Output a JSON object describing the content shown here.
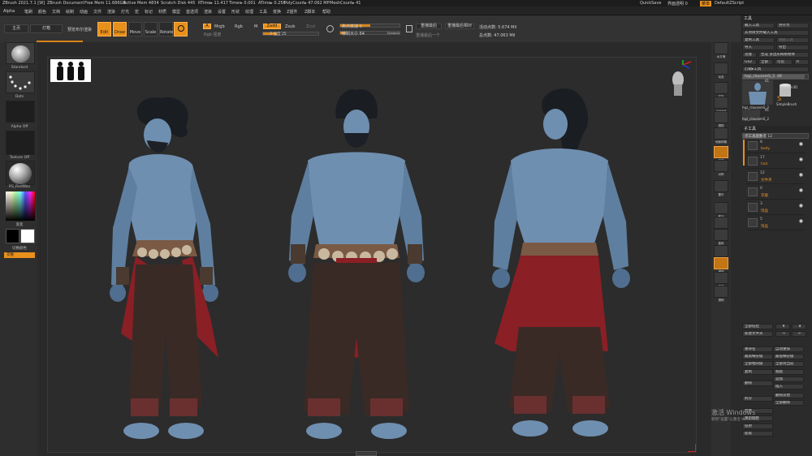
{
  "status_bar": {
    "app": "ZBrush 2021.7.1 [W]",
    "doc": "ZBrush Document",
    "free_mem": "Free Mem 11.686GB",
    "active_mem": "Active Mem 4834",
    "scratch": "Scratch Disk 445",
    "rtime": "RTime▸ 11.417",
    "timer": "Timer▸ 0.001",
    "atime": "ATime▸ 0.256",
    "polycount": "PolyCount▸ 47.062 MP",
    "meshcount": "MeshCount▸ 41",
    "quicksave": "QuickSave",
    "transparency": "界面透明 0",
    "menus_btn": "菜单",
    "default_script": "DefaultZScript"
  },
  "menu_items": [
    "Alpha",
    "笔刷",
    "颜色",
    "文档",
    "绘制",
    "动画",
    "文件",
    "渲染",
    "灯光",
    "宏",
    "标记",
    "材质",
    "模型",
    "首选项",
    "渲染",
    "设置",
    "形状",
    "纹理",
    "工具",
    "变换",
    "Z插件",
    "Z脚本",
    "帮助"
  ],
  "toolbar": {
    "home": "主页",
    "lightbox": "灯箱",
    "preview": "预览布尔渲染",
    "edit": "Edit",
    "draw": "Draw",
    "move": "Move",
    "scale": "Scale",
    "rotate": "Rotate",
    "a_label": "A",
    "mrgb": "Mrgb",
    "rgb": "Rgb",
    "m": "M",
    "zadd": "Zadd",
    "zsub": "Zsub",
    "zcut": "Zcut",
    "rgb_intensity": "Rgb 强度",
    "z_intensity": "Z 强度 25",
    "focal_shift": "焦点衰减 0",
    "draw_size": "绘制大小 64",
    "dynamic": "Dynamic",
    "replay_last": "重播最后",
    "replay_rel": "重播最后相对",
    "replay_last2": "重播最后一个",
    "active_points": "活动点数: 5.674 Mil",
    "total_points": "总点数: 47.063 Mil"
  },
  "left_panel": {
    "brush": "Standard",
    "stroke": "Dots",
    "alpha": "Alpha Off",
    "texture": "Texture Off",
    "material": "RS_RedWax",
    "gradient": "渐变",
    "switch_color": "切换颜色",
    "alternate": "交替"
  },
  "right_strip": [
    {
      "label": "水平滑"
    },
    {
      "label": "动态"
    },
    {
      "label": "实际"
    },
    {
      "label": "AAHalf"
    },
    {
      "label": "透视"
    },
    {
      "label": "地面网格"
    },
    {
      "label": "局部"
    },
    {
      "label": "对称"
    },
    {
      "label": "置中"
    },
    {
      "label": "移动"
    },
    {
      "label": "缩放"
    },
    {
      "label": "旋转"
    },
    {
      "label": "Line Fill"
    },
    {
      "label": "透明"
    },
    {
      "label": "实体"
    },
    {
      "label": "透明"
    }
  ],
  "right_panel": {
    "title": "工具",
    "load_tool": "载入工具",
    "save_as": "另存为",
    "load_from_project": "从项目文件载入工具",
    "copy_tool": "复制工具",
    "paste_tool": "粘贴工具",
    "import": "导入",
    "export": "导出",
    "clone": "克隆",
    "make_polymesh": "生成 多边形网格物体",
    "goz": "GoZ",
    "all": "全部",
    "visible": "可见",
    "r": "R",
    "lightbox_tool": "灯箱▸工具",
    "current_tool": "hqz_clousemS_2. 48",
    "thumb1": "hqz_clousemS_2",
    "thumb2": "Cylinder3D",
    "thumb3": "SimpleBrush",
    "thumb4": "hqz_clousemS_2",
    "count1": "41",
    "count2": "41",
    "subtool_title": "子工具",
    "subtool_count": "子工具底数量 12",
    "subtools": [
      {
        "num": "8",
        "name": "body"
      },
      {
        "num": "17",
        "name": "hair"
      },
      {
        "num": "12",
        "name": "文件夹"
      },
      {
        "num": "0",
        "name": "衣服"
      },
      {
        "num": "3",
        "name": "饰品"
      },
      {
        "num": "5",
        "name": "饰品"
      }
    ],
    "all_low": "全部低位",
    "new_folder": "新建文件夹",
    "rename": "重命名",
    "auto_reorder": "自动重排",
    "all_to_top": "最高细分级",
    "all_to_low": "最低细分级",
    "all_to_same": "全部相同级",
    "all_to_current": "全部到当前",
    "copy": "复制",
    "paste": "粘贴",
    "append": "追加",
    "insert": "插入",
    "delete": "删除",
    "delete_other": "删除其他",
    "delete_all": "全部删除",
    "split": "拆分",
    "merge": "合并",
    "remesh": "重新网格",
    "project": "投射",
    "extract": "提取"
  },
  "watermark": {
    "line1": "激活 Windows",
    "line2": "转到\"设置\"以激活 Windows。"
  },
  "colors": {
    "accent": "#e8901c",
    "skin": "#6f8fb0",
    "skin_dark": "#3f5a78",
    "sash": "#8a1f25",
    "pants": "#3a2a26",
    "hair": "#1a1d22"
  }
}
